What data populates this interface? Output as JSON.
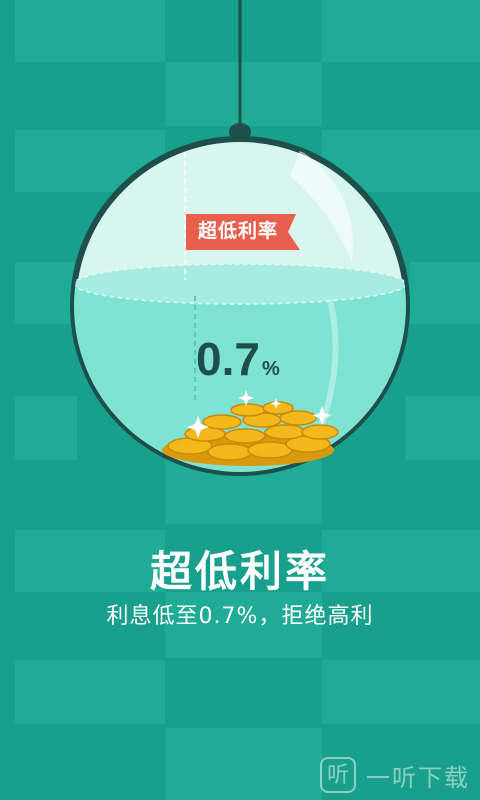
{
  "flag": {
    "label": "超低利率"
  },
  "rate": {
    "value": "0.7",
    "unit": "%"
  },
  "heading": "超低利率",
  "subheading": "利息低至0.7%，拒绝高利",
  "watermark": {
    "logo": "听",
    "text": "一听下载"
  },
  "colors": {
    "background": "#19a08c",
    "water": "#7fe3d4",
    "flag": "#e8604c",
    "coin": "#f2b81c"
  },
  "icons": [
    "sparkle-icon",
    "coin-icon"
  ]
}
